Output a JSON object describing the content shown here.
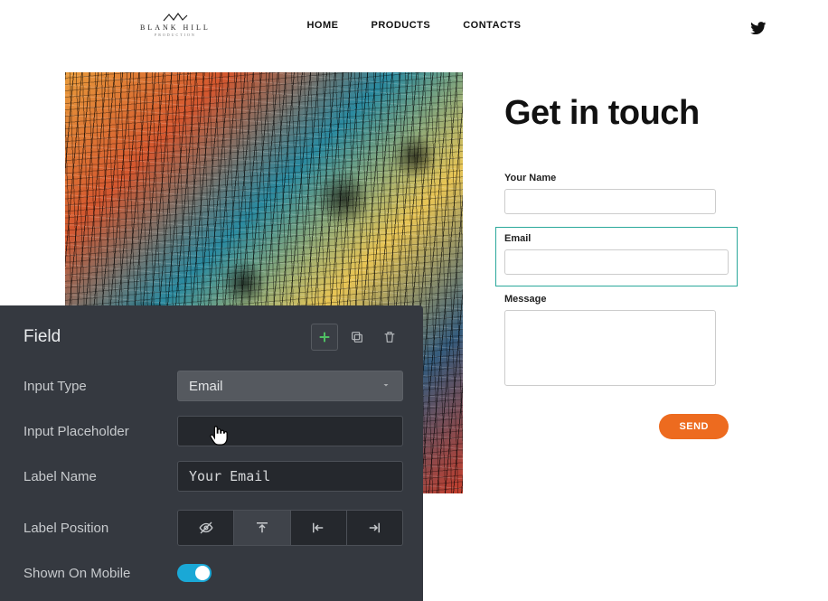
{
  "header": {
    "brand_name": "BLANK HILL",
    "brand_sub": "PRODUCTION",
    "nav": [
      "HOME",
      "PRODUCTS",
      "CONTACTS"
    ]
  },
  "contact": {
    "title": "Get in touch",
    "name_label": "Your Name",
    "name_value": "",
    "name_placeholder": "",
    "email_label": "Email",
    "email_value": "",
    "email_placeholder": "",
    "message_label": "Message",
    "message_value": "",
    "message_placeholder": "",
    "send_label": "SEND"
  },
  "editor": {
    "panel_title": "Field",
    "rows": {
      "input_type_label": "Input Type",
      "input_type_value": "Email",
      "placeholder_label": "Input Placeholder",
      "placeholder_value": "",
      "label_name_label": "Label Name",
      "label_name_value": "Your Email",
      "label_position_label": "Label Position",
      "shown_on_mobile_label": "Shown On Mobile",
      "shown_on_mobile_value": true
    },
    "icons": {
      "add": "plus",
      "duplicate": "copy",
      "delete": "trash"
    }
  }
}
